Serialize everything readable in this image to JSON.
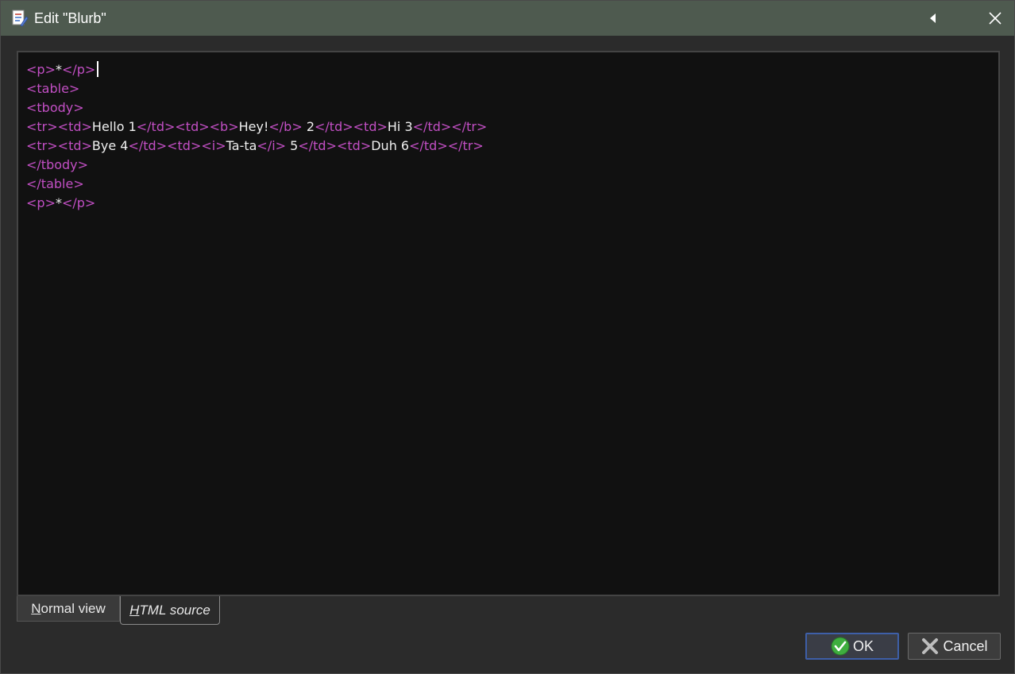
{
  "window": {
    "title": "Edit \"Blurb\""
  },
  "titlebar": {
    "icon": "document-edit-icon",
    "collapse_icon": "triangle-left-icon",
    "close_icon": "close-icon"
  },
  "editor": {
    "lines": [
      [
        {
          "t": "tag",
          "v": "<p>"
        },
        {
          "t": "txt",
          "v": "*"
        },
        {
          "t": "tag",
          "v": "</p>"
        }
      ],
      [
        {
          "t": "tag",
          "v": "<table>"
        }
      ],
      [
        {
          "t": "tag",
          "v": "<tbody>"
        }
      ],
      [
        {
          "t": "tag",
          "v": "<tr>"
        },
        {
          "t": "tag",
          "v": "<td>"
        },
        {
          "t": "txt",
          "v": "Hello 1"
        },
        {
          "t": "tag",
          "v": "</td>"
        },
        {
          "t": "tag",
          "v": "<td>"
        },
        {
          "t": "tag",
          "v": "<b>"
        },
        {
          "t": "txt",
          "v": "Hey!"
        },
        {
          "t": "tag",
          "v": "</b>"
        },
        {
          "t": "txt",
          "v": " 2"
        },
        {
          "t": "tag",
          "v": "</td>"
        },
        {
          "t": "tag",
          "v": "<td>"
        },
        {
          "t": "txt",
          "v": "Hi 3"
        },
        {
          "t": "tag",
          "v": "</td>"
        },
        {
          "t": "tag",
          "v": "</tr>"
        }
      ],
      [
        {
          "t": "tag",
          "v": "<tr>"
        },
        {
          "t": "tag",
          "v": "<td>"
        },
        {
          "t": "txt",
          "v": "Bye 4"
        },
        {
          "t": "tag",
          "v": "</td>"
        },
        {
          "t": "tag",
          "v": "<td>"
        },
        {
          "t": "tag",
          "v": "<i>"
        },
        {
          "t": "txt",
          "v": "Ta-ta"
        },
        {
          "t": "tag",
          "v": "</i>"
        },
        {
          "t": "txt",
          "v": " 5"
        },
        {
          "t": "tag",
          "v": "</td>"
        },
        {
          "t": "tag",
          "v": "<td>"
        },
        {
          "t": "txt",
          "v": "Duh 6"
        },
        {
          "t": "tag",
          "v": "</td>"
        },
        {
          "t": "tag",
          "v": "</tr>"
        }
      ],
      [
        {
          "t": "tag",
          "v": "</tbody>"
        }
      ],
      [
        {
          "t": "tag",
          "v": "</table>"
        }
      ],
      [
        {
          "t": "tag",
          "v": "<p>"
        },
        {
          "t": "txt",
          "v": "*"
        },
        {
          "t": "tag",
          "v": "</p>"
        }
      ]
    ],
    "tag_color": "#c24fc4",
    "text_color": "#f0f0f0",
    "background": "#111111"
  },
  "tabs": [
    {
      "label_mnemonic": "N",
      "label_rest": "ormal view",
      "selected": false
    },
    {
      "label_mnemonic": "H",
      "label_rest": "TML source",
      "selected": true
    }
  ],
  "buttons": {
    "ok_label": "OK",
    "ok_icon": "check-circle-icon",
    "cancel_label": "Cancel",
    "cancel_icon": "x-icon"
  },
  "colors": {
    "titlebar": "#4e5a4f",
    "ok_border": "#3e5fa8",
    "ok_icon_green": "#3fae3f"
  }
}
